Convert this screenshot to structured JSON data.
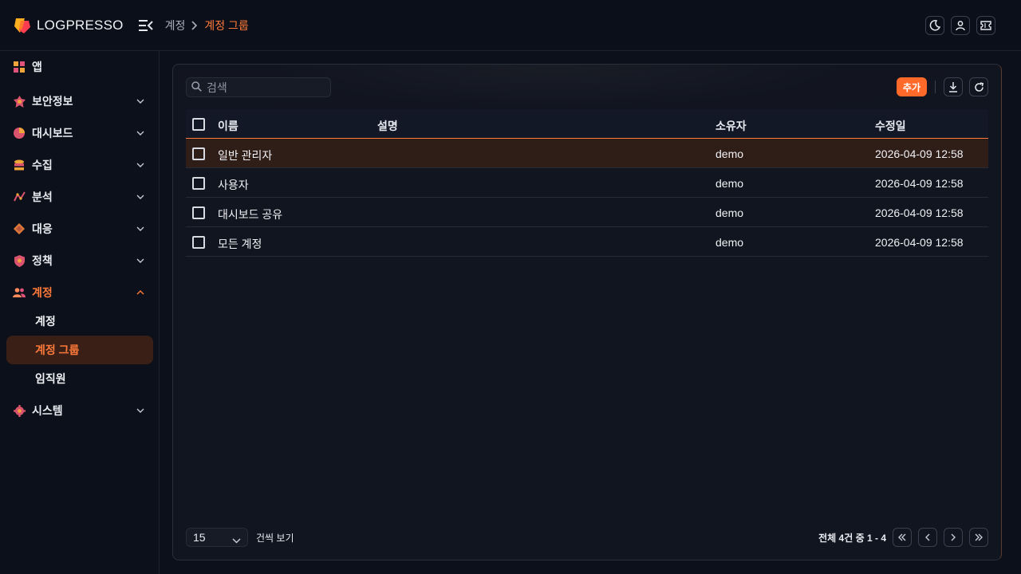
{
  "header": {
    "logo_text": "LOGPRESSO",
    "breadcrumb": [
      "계정",
      "계정 그룹"
    ]
  },
  "sidebar": {
    "items": [
      {
        "label": "앱",
        "icon": "apps-icon"
      },
      {
        "label": "보안정보",
        "icon": "security-info-icon"
      },
      {
        "label": "대시보드",
        "icon": "dashboard-icon"
      },
      {
        "label": "수집",
        "icon": "collection-icon"
      },
      {
        "label": "분석",
        "icon": "analysis-icon"
      },
      {
        "label": "대응",
        "icon": "response-icon"
      },
      {
        "label": "정책",
        "icon": "policy-icon"
      },
      {
        "label": "계정",
        "icon": "users-icon"
      },
      {
        "label": "시스템",
        "icon": "system-gear-icon"
      }
    ],
    "sub_items": [
      "계정",
      "계정 그룹",
      "임직원"
    ]
  },
  "search": {
    "placeholder": "검색",
    "value": ""
  },
  "toolbar": {
    "add_label": "추가"
  },
  "table": {
    "columns": [
      "이름",
      "설명",
      "소유자",
      "수정일"
    ],
    "rows": [
      {
        "name": "일반 관리자",
        "description": "",
        "owner": "demo",
        "modified": "2026-04-09 12:58"
      },
      {
        "name": "사용자",
        "description": "",
        "owner": "demo",
        "modified": "2026-04-09 12:58"
      },
      {
        "name": "대시보드 공유",
        "description": "",
        "owner": "demo",
        "modified": "2026-04-09 12:58"
      },
      {
        "name": "모든 계정",
        "description": "",
        "owner": "demo",
        "modified": "2026-04-09 12:58"
      }
    ]
  },
  "footer": {
    "page_size": "15",
    "per_page_label": "건씩 보기",
    "total_label": "전체 4건 중 1 - 4"
  },
  "colors": {
    "accent": "#ff7a3a",
    "background": "#0c101a",
    "panel": "#121520"
  }
}
